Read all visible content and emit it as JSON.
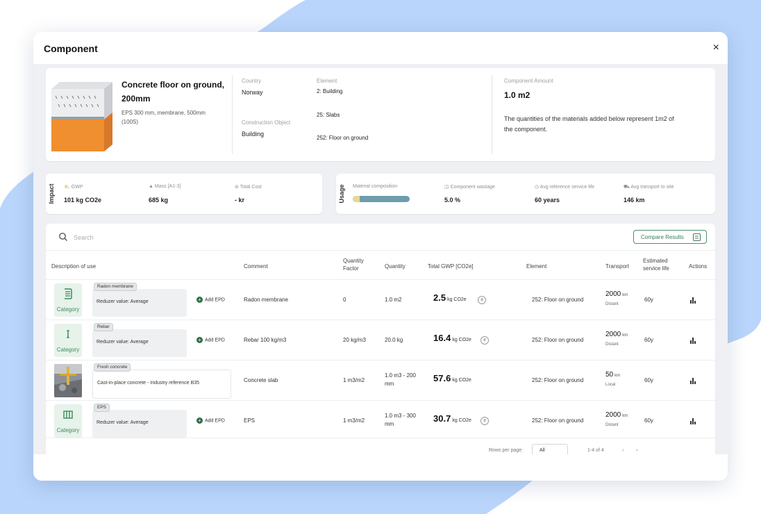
{
  "colors": {
    "accent": "#3d7a58",
    "background_shape": "#b9d5fb",
    "category_bg": "#e6f2ea"
  },
  "modal": {
    "title": "Component",
    "close": "×"
  },
  "component": {
    "name": "Concrete floor on ground, 200mm",
    "description": "EPS 300 mm, membrane, 500mm (100S)",
    "country_label": "Country",
    "country": "Norway",
    "construction_object_label": "Construction Object",
    "construction_object": "Building",
    "element_label": "Element",
    "elements": [
      "2: Building",
      "25: Slabs",
      "252: Floor on ground"
    ],
    "amount_label": "Component Amount",
    "amount": "1.0 m2",
    "amount_note": "The quantities of the materials added below represent 1m2 of the component."
  },
  "impact": {
    "label": "Impact",
    "stats": [
      {
        "label": "GWP",
        "value": "101 kg CO2e"
      },
      {
        "label": "Mass [A1-3]",
        "value": "685 kg"
      },
      {
        "label": "Total Cost",
        "value": "- kr"
      }
    ]
  },
  "usage": {
    "label": "Usage",
    "material_composition_label": "Material composition",
    "material_composition_fraction": 0.12,
    "stats": [
      {
        "label": "Component wastage",
        "value": "5.0 %"
      },
      {
        "label": "Avg reference service life",
        "value": "60 years"
      },
      {
        "label": "Avg transport to site",
        "value": "146 km"
      }
    ]
  },
  "search": {
    "placeholder": "Search"
  },
  "compare_button": "Compare Results",
  "table": {
    "headers": {
      "description": "Description of use",
      "comment": "Comment",
      "quantity_factor": "Quantity Factor",
      "quantity": "Quantity",
      "total_gwp": "Total GWP [CO2e]",
      "element": "Element",
      "transport": "Transport",
      "service_life": "Estimated service life",
      "actions": "Actions"
    },
    "category_label": "Category",
    "add_epd": "Add EPD",
    "rows": [
      {
        "tag": "Radon membrane",
        "detail": "Reduzer value: Average",
        "comment": "Radon membrane",
        "quantity_factor": "0",
        "quantity": "1.0 m2",
        "gwp_value": "2.5",
        "gwp_unit": "kg CO2e",
        "element": "252: Floor on ground",
        "transport_value": "2000",
        "transport_unit": "km",
        "transport_type": "Distant",
        "service_life": "60y"
      },
      {
        "tag": "Rebar",
        "detail": "Reduzer value: Average",
        "comment": "Rebar 100 kg/m3",
        "quantity_factor": "20 kg/m3",
        "quantity": "20.0 kg",
        "gwp_value": "16.4",
        "gwp_unit": "kg CO2e",
        "element": "252: Floor on ground",
        "transport_value": "2000",
        "transport_unit": "km",
        "transport_type": "Distant",
        "service_life": "60y"
      },
      {
        "tag": "Fresh concrete",
        "detail": "Cast-in-place concrete - Industry reference B35",
        "comment": "Concrete slab",
        "quantity_factor": "1 m3/m2",
        "quantity": "1.0 m3 - 200 mm",
        "gwp_value": "57.6",
        "gwp_unit": "kg CO2e",
        "element": "252: Floor on ground",
        "transport_value": "50",
        "transport_unit": "km",
        "transport_type": "Local",
        "service_life": "60y"
      },
      {
        "tag": "EPS",
        "detail": "Reduzer value: Average",
        "comment": "EPS",
        "quantity_factor": "1 m3/m2",
        "quantity": "1.0 m3 - 300 mm",
        "gwp_value": "30.7",
        "gwp_unit": "kg CO2e",
        "element": "252: Floor on ground",
        "transport_value": "2000",
        "transport_unit": "km",
        "transport_type": "Distant",
        "service_life": "60y"
      }
    ]
  },
  "pagination": {
    "rows_per_page_label": "Rows per page:",
    "rows_per_page": "All",
    "range": "1-4 of 4"
  }
}
